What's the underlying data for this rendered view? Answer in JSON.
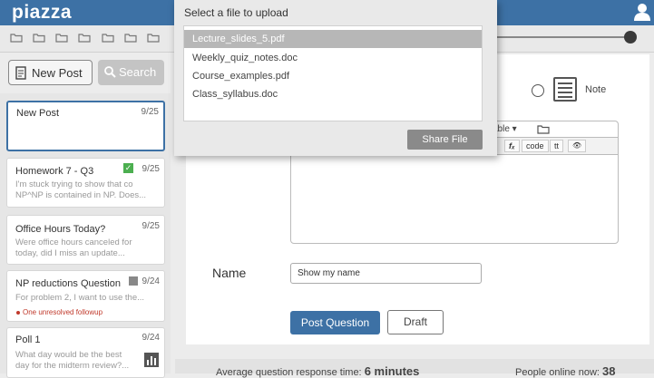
{
  "app": {
    "logo": "piazza"
  },
  "sidebar": {
    "new_post_label": "New Post",
    "search_label": "Search",
    "posts": [
      {
        "title": "New Post",
        "date": "9/25",
        "preview": "",
        "followup": ""
      },
      {
        "title": "Homework 7 - Q3",
        "date": "9/25",
        "preview": "I'm stuck trying to show that co NP^NP is contained in NP. Does...",
        "followup": ""
      },
      {
        "title": "Office Hours Today?",
        "date": "9/25",
        "preview": "Were office hours canceled for today, did I miss an update...",
        "followup": ""
      },
      {
        "title": "NP reductions Question",
        "date": "9/24",
        "preview": "For problem 2, I want to use the...",
        "followup": "One unresolved followup"
      },
      {
        "title": "Poll 1",
        "date": "9/24",
        "preview": "What day would be the best day for the midterm review?...",
        "followup": ""
      }
    ]
  },
  "composer": {
    "note_label": "Note",
    "toolbar_table": "able ▾",
    "fmt_fx": "fₓ",
    "fmt_code": "code",
    "fmt_tt": "tt",
    "fmt_eye": "👁",
    "name_label": "Name",
    "name_value": "Show my name",
    "post_label": "Post Question",
    "draft_label": "Draft"
  },
  "footer": {
    "response_label": "Average question response time:",
    "response_value": "6 minutes",
    "online_label": "People online now:",
    "online_value": "38"
  },
  "dialog": {
    "title": "Select a file to upload",
    "files": [
      "Lecture_slides_5.pdf",
      "Weekly_quiz_notes.doc",
      "Course_examples.pdf",
      "Class_syllabus.doc"
    ],
    "selected_index": 0,
    "share_label": "Share File"
  },
  "colors": {
    "brand": "#3d71a5",
    "selected_file": "#b7b7b7",
    "followup_dot": "#c0392b",
    "check_badge": "#4caf50"
  }
}
